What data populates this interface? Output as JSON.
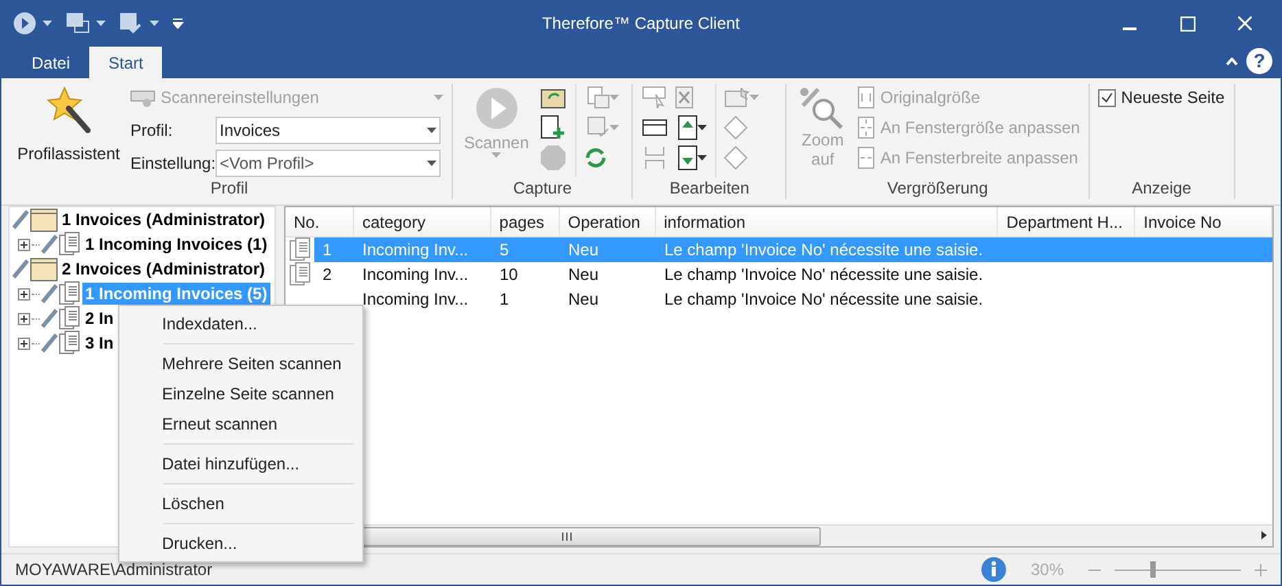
{
  "window": {
    "title": "Therefore™ Capture Client",
    "help": "?"
  },
  "ribbon_tabs": [
    {
      "label": "Datei",
      "selected": false
    },
    {
      "label": "Start",
      "selected": true
    }
  ],
  "profil_group": {
    "label": "Profil",
    "wizard": "Profilassistent",
    "scanner_settings": {
      "label": "Scannereinstellungen",
      "disabled": true
    },
    "fields": [
      {
        "label": "Profil:",
        "value": "Invoices"
      },
      {
        "label": "Einstellung:",
        "value": "<Vom Profil>"
      }
    ]
  },
  "capture_group": {
    "label": "Capture",
    "scan": {
      "label": "Scannen",
      "disabled": true
    }
  },
  "edit_group": {
    "label": "Bearbeiten"
  },
  "zoom_group": {
    "label": "Vergrößerung",
    "zoom": {
      "label": "Zoom auf",
      "disabled": true
    },
    "items": [
      {
        "label": "Originalgröße",
        "kind": "original",
        "disabled": true
      },
      {
        "label": "An Fenstergröße anpassen",
        "kind": "fit",
        "disabled": true
      },
      {
        "label": "An Fensterbreite anpassen",
        "kind": "width",
        "disabled": true
      }
    ]
  },
  "view_group": {
    "label": "Anzeige",
    "checkbox": {
      "label": "Neueste Seite",
      "checked": true
    }
  },
  "tree": [
    {
      "label": "1 Invoices (Administrator)",
      "kind": "batch",
      "selected": false,
      "children": [
        {
          "label": "1 Incoming Invoices (1)",
          "kind": "document",
          "selected": false,
          "expanded": false
        }
      ]
    },
    {
      "label": "2 Invoices (Administrator)",
      "kind": "batch",
      "selected": false,
      "children": [
        {
          "label": "1 Incoming Invoices (5)",
          "kind": "document",
          "selected": true,
          "expanded": false
        },
        {
          "label": "2 In",
          "kind": "document",
          "selected": false,
          "expanded": false
        },
        {
          "label": "3 In",
          "kind": "document",
          "selected": false,
          "expanded": false
        }
      ]
    }
  ],
  "table": {
    "columns": [
      "No.",
      "category",
      "pages",
      "Operation",
      "information",
      "Department H...",
      "Invoice No"
    ],
    "rows": [
      {
        "no": "1",
        "category": "Incoming Inv...",
        "pages": "5",
        "operation": "Neu",
        "information": "Le champ 'Invoice No' nécessite une saisie.",
        "selected": true
      },
      {
        "no": "2",
        "category": "Incoming Inv...",
        "pages": "10",
        "operation": "Neu",
        "information": "Le champ 'Invoice No' nécessite une saisie.",
        "selected": false
      },
      {
        "category": "Incoming Inv...",
        "pages": "1",
        "operation": "Neu",
        "information": "Le champ 'Invoice No' nécessite une saisie.",
        "selected": false
      }
    ]
  },
  "context_menu": [
    {
      "kind": "item",
      "label": "Indexdaten..."
    },
    {
      "kind": "separator"
    },
    {
      "kind": "item",
      "label": "Mehrere Seiten scannen"
    },
    {
      "kind": "item",
      "label": "Einzelne Seite scannen"
    },
    {
      "kind": "item",
      "label": "Erneut scannen"
    },
    {
      "kind": "separator"
    },
    {
      "kind": "item",
      "label": "Datei hinzufügen..."
    },
    {
      "kind": "separator"
    },
    {
      "kind": "item",
      "label": "Löschen"
    },
    {
      "kind": "separator"
    },
    {
      "kind": "item",
      "label": "Drucken..."
    }
  ],
  "status_bar": {
    "user": "MOYAWARE\\Administrator",
    "zoom": "30%",
    "level": 0.3
  }
}
